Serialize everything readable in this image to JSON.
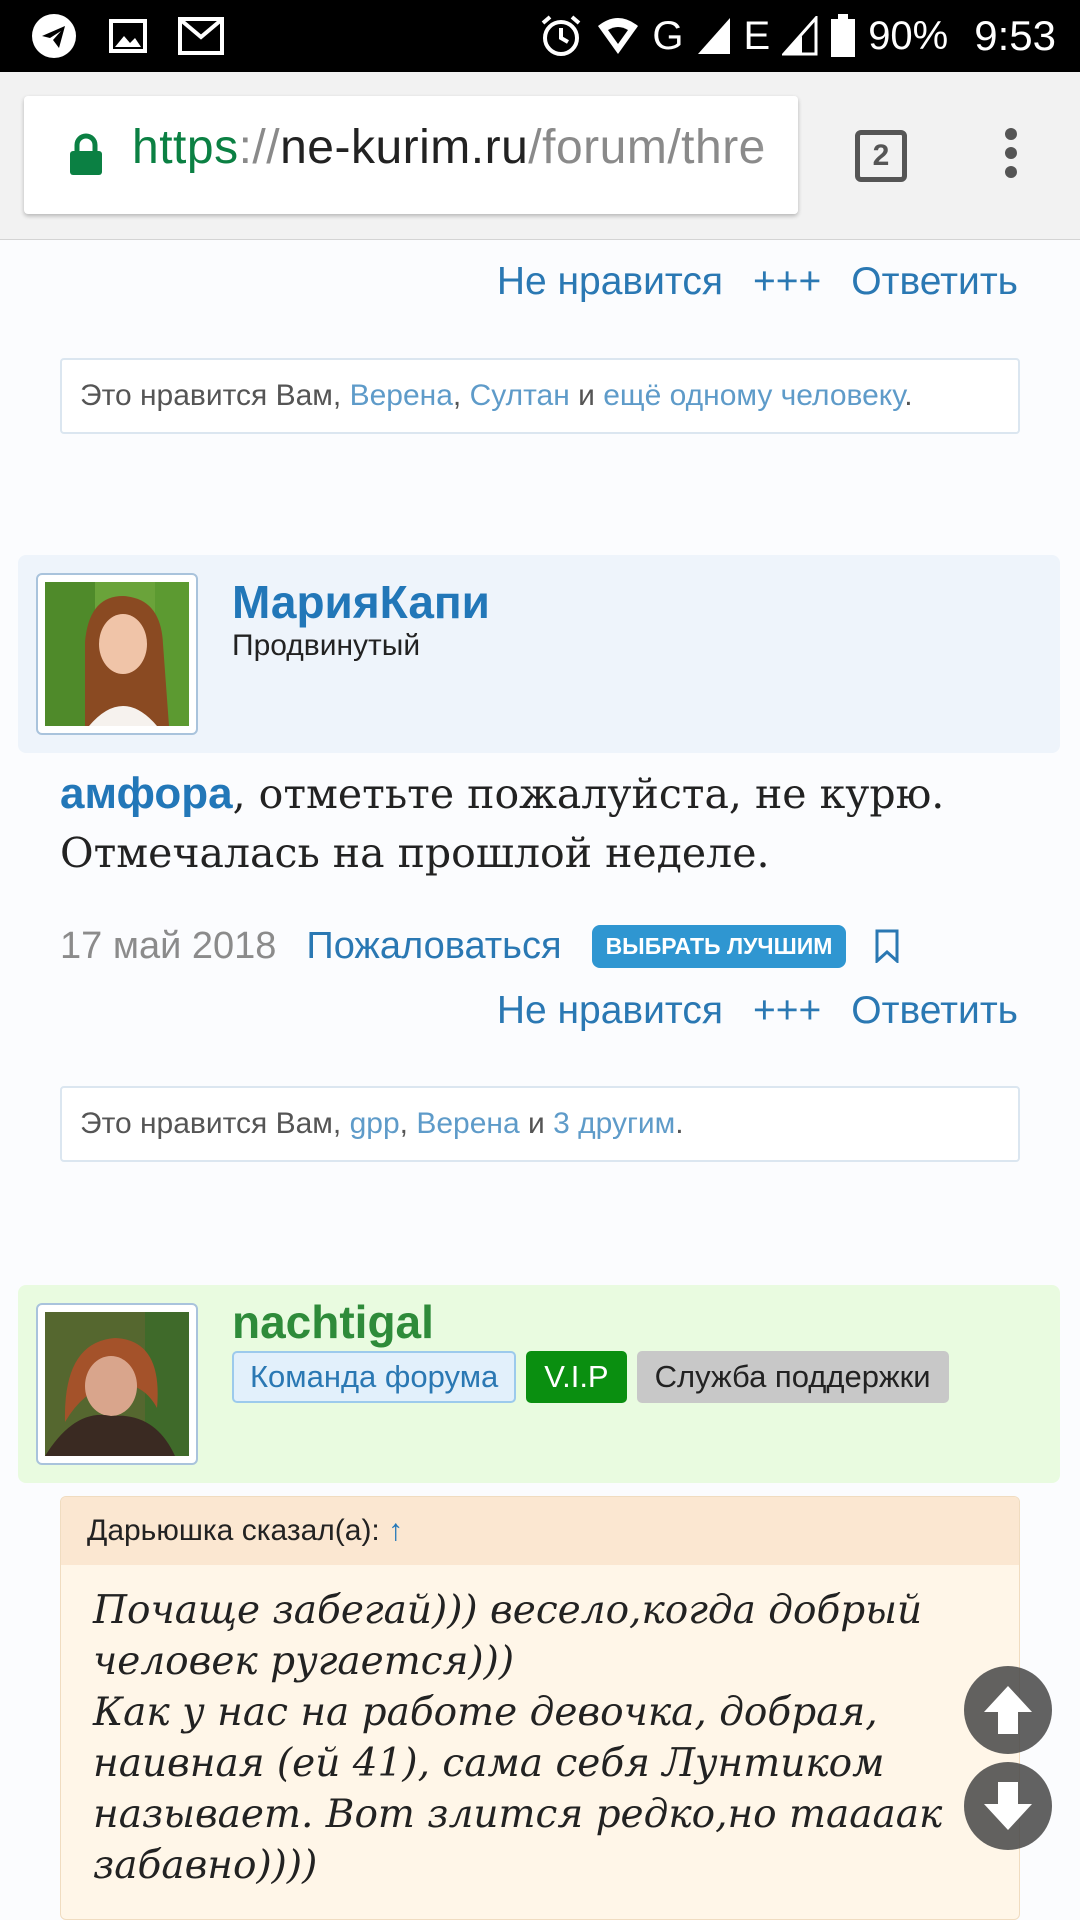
{
  "status_bar": {
    "battery": "90%",
    "time": "9:53",
    "network_g": "G",
    "network_e": "E"
  },
  "browser": {
    "url_scheme": "https",
    "url_sep": "://",
    "url_host": "ne-kurim.ru",
    "url_path": "/forum/thre",
    "tab_count": "2"
  },
  "top_post": {
    "actions": [
      "Не нравится",
      "+++",
      "Ответить"
    ],
    "likes": {
      "prefix": "Это нравится Вам, ",
      "user1": "Верена",
      "sep": ", ",
      "user2": "Султан",
      "and": " и ",
      "others": "ещё одному человеку",
      "end": "."
    }
  },
  "post1": {
    "username": "МарияКапи",
    "user_title": "Продвинутый",
    "mention": "амфора",
    "text": ", отметьте пожалуйста, не курю. Отмечалась на прошлой неделе.",
    "date": "17 май 2018",
    "report": "Пожаловаться",
    "best_button": "ВЫБРАТЬ ЛУЧШИМ",
    "actions": [
      "Не нравится",
      "+++",
      "Ответить"
    ],
    "likes": {
      "prefix": "Это нравится Вам, ",
      "user1": "gpp",
      "sep": ", ",
      "user2": "Верена",
      "and": " и ",
      "others": "3 другим",
      "end": "."
    }
  },
  "post2": {
    "username": "nachtigal",
    "badges": [
      "Команда форума",
      "V.I.P",
      "Служба поддержки"
    ],
    "quote_author": "Дарьюшка сказал(а): ",
    "quote_arrow": "↑",
    "quote_text": "Почаще забегай))) весело,когда добрый человек ругается)))\nКак у нас на работе девочка, добрая, наивная (ей 41), сама себя Лунтиком называет. Вот злится редко,но таааак забавно))))"
  },
  "colors": {
    "link": "#2277b8",
    "username_green": "#2e8b3a",
    "vip_green": "#0a8f10",
    "header_blue": "#eef4fb",
    "header_green": "#e9fbe0"
  }
}
